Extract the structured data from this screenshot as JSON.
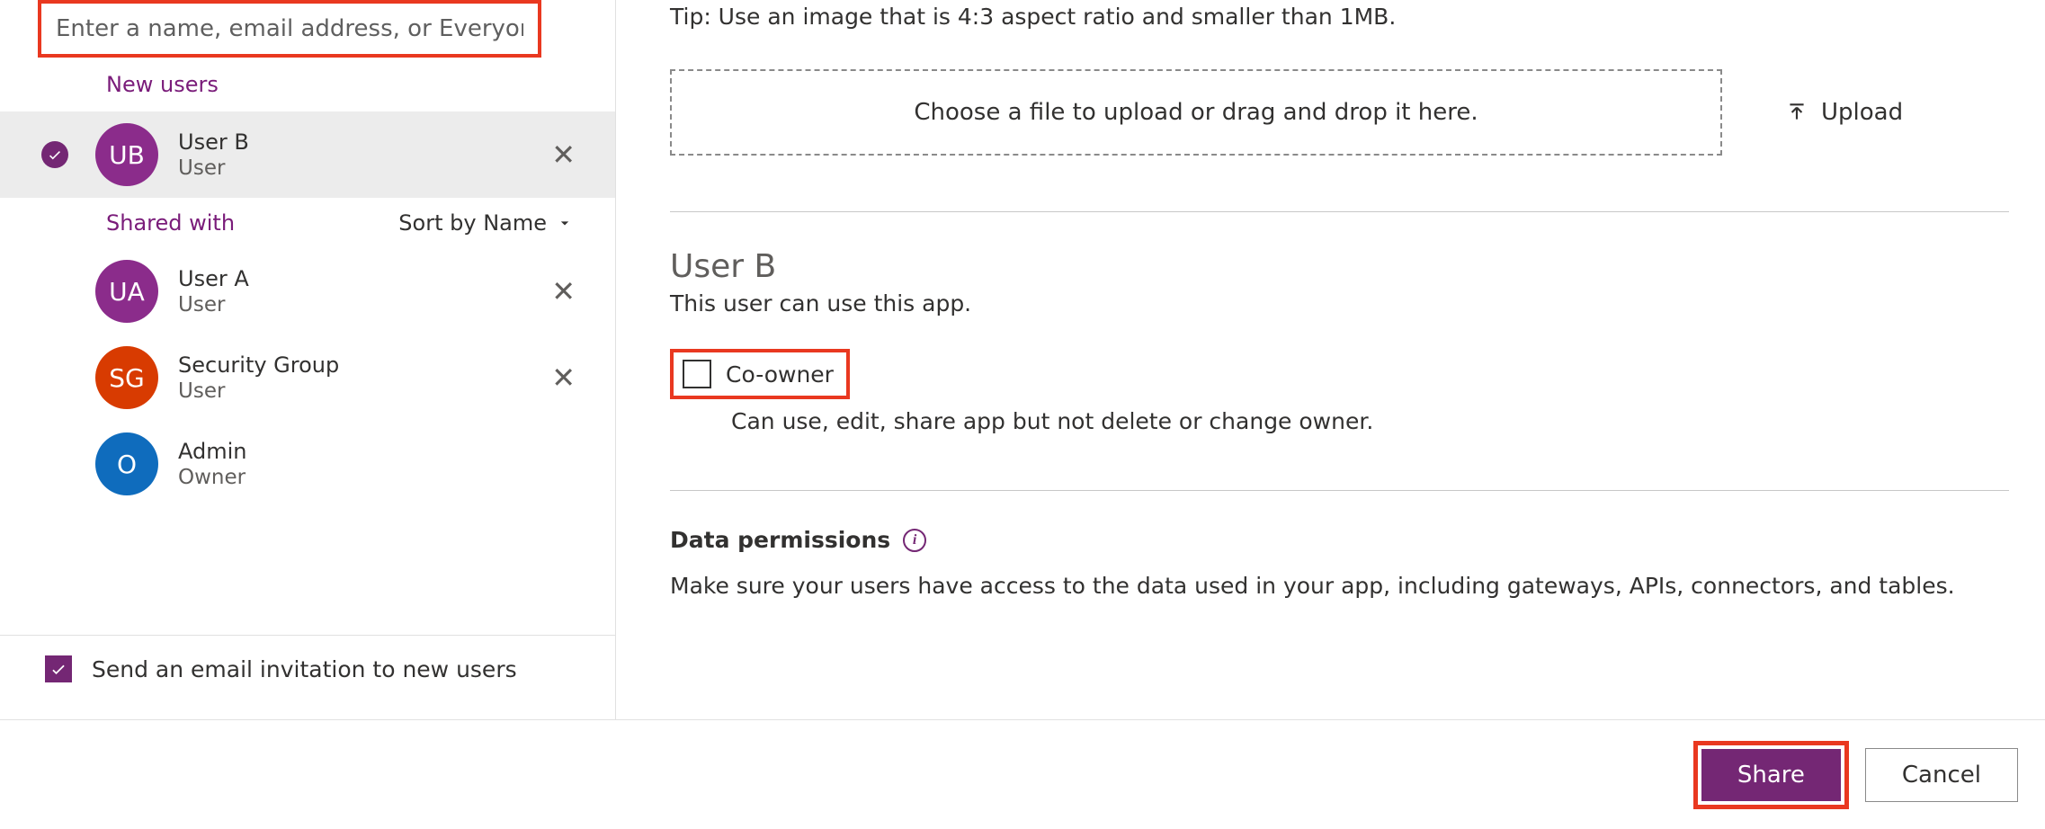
{
  "search": {
    "placeholder": "Enter a name, email address, or Everyone"
  },
  "sections": {
    "new_users": "New users",
    "shared_with": "Shared with"
  },
  "sort": {
    "label": "Sort by Name"
  },
  "users": {
    "new": [
      {
        "initials": "UB",
        "name": "User B",
        "role": "User",
        "avatar_color": "purple"
      }
    ],
    "shared": [
      {
        "initials": "UA",
        "name": "User A",
        "role": "User",
        "avatar_color": "purple"
      },
      {
        "initials": "SG",
        "name": "Security Group",
        "role": "User",
        "avatar_color": "red"
      },
      {
        "initials": "O",
        "name": "Admin",
        "role": "Owner",
        "avatar_color": "blue"
      }
    ]
  },
  "email_invite": {
    "label": "Send an email invitation to new users",
    "checked": true
  },
  "tip": "Tip: Use an image that is 4:3 aspect ratio and smaller than 1MB.",
  "dropzone": "Choose a file to upload or drag and drop it here.",
  "upload_btn": "Upload",
  "selected_user": {
    "name": "User B",
    "desc": "This user can use this app."
  },
  "coowner": {
    "label": "Co-owner",
    "desc": "Can use, edit, share app but not delete or change owner.",
    "checked": false
  },
  "data_permissions": {
    "title": "Data permissions",
    "desc": "Make sure your users have access to the data used in your app, including gateways, APIs, connectors, and tables."
  },
  "buttons": {
    "share": "Share",
    "cancel": "Cancel"
  }
}
